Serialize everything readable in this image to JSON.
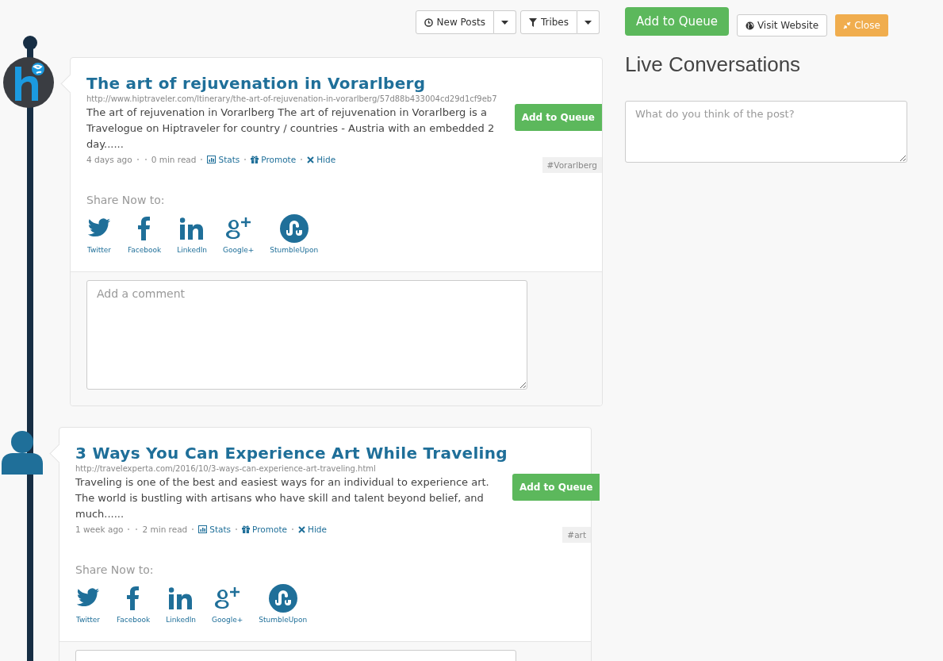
{
  "toolbar": {
    "filters": [
      {
        "kind": "clock",
        "label": "New Posts"
      },
      {
        "kind": "filter",
        "label": "Tribes"
      }
    ]
  },
  "posts": [
    {
      "kind": "logo",
      "title": "The art of rejuvenation in Vorarlberg",
      "url": "http://www.hiptraveler.com/ltinerary/the-art-of-rejuvenation-in-vorarlberg/57d88b433004cd29d1cf9eb7",
      "summary": "The art of rejuvenation in Vorarlberg The art of rejuvenation in Vorarlberg is a Travelogue on Hiptraveler for country / countries - Austria with an embedded 2 day......",
      "queue_button": "Add to Queue",
      "time": "4 days ago",
      "read": "0 min read",
      "actions": [
        {
          "kind": "stats",
          "label": "Stats"
        },
        {
          "kind": "promote",
          "label": "Promote"
        },
        {
          "kind": "hide",
          "label": "Hide"
        }
      ],
      "tag": "#Vorarlberg",
      "share_heading": "Share Now to:",
      "share": [
        {
          "kind": "twitter",
          "label": "Twitter"
        },
        {
          "kind": "facebook",
          "label": "Facebook"
        },
        {
          "kind": "linkedin",
          "label": "LinkedIn"
        },
        {
          "kind": "google",
          "label": "Google+"
        },
        {
          "kind": "stumble",
          "label": "StumbleUpon"
        }
      ],
      "comment_placeholder": "Add a comment"
    },
    {
      "kind": "person",
      "title": "3 Ways You Can Experience Art While Traveling",
      "url": "http://travelexperta.com/2016/10/3-ways-can-experience-art-traveling.html",
      "summary": "Traveling is one of the best and easiest ways for an individual to experience art. The world is bustling with artisans who have skill and talent beyond belief, and much......",
      "queue_button": "Add to Queue",
      "time": "1 week ago",
      "read": "2 min read",
      "actions": [
        {
          "kind": "stats",
          "label": "Stats"
        },
        {
          "kind": "promote",
          "label": "Promote"
        },
        {
          "kind": "hide",
          "label": "Hide"
        }
      ],
      "tag": "#art",
      "share_heading": "Share Now to:",
      "share": [
        {
          "kind": "twitter",
          "label": "Twitter"
        },
        {
          "kind": "facebook",
          "label": "Facebook"
        },
        {
          "kind": "linkedin",
          "label": "LinkedIn"
        },
        {
          "kind": "google",
          "label": "Google+"
        },
        {
          "kind": "stumble",
          "label": "StumbleUpon"
        }
      ]
    }
  ],
  "side": {
    "queue_button": "Add to Queue",
    "visit_button": "Visit Website",
    "close_button": "Close",
    "heading": "Live Conversations",
    "conversation_placeholder": "What do you think of the post?"
  }
}
